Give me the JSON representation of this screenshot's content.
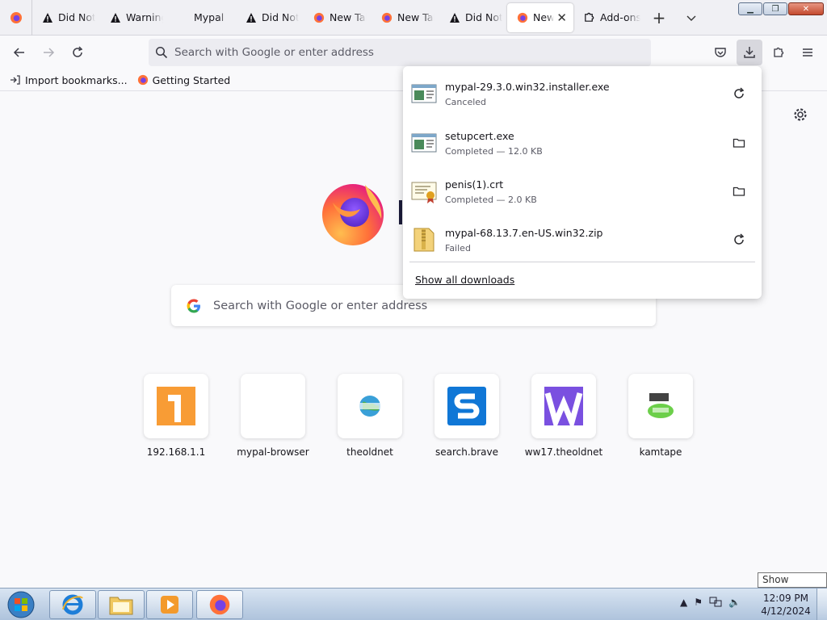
{
  "tabs": [
    {
      "label": "Did Not",
      "icon": "warning-icon"
    },
    {
      "label": "Warning",
      "icon": "warning-icon"
    },
    {
      "label": "Mypal",
      "icon": "none"
    },
    {
      "label": "Did Not",
      "icon": "warning-icon"
    },
    {
      "label": "New Tab",
      "icon": "firefox-icon"
    },
    {
      "label": "New Tab",
      "icon": "firefox-icon"
    },
    {
      "label": "Did Not",
      "icon": "warning-icon"
    },
    {
      "label": "New",
      "icon": "firefox-icon",
      "active": true
    },
    {
      "label": "Add-ons",
      "icon": "puzzle-icon"
    }
  ],
  "toolbar": {
    "url_placeholder": "Search with Google or enter address"
  },
  "bookmarks": [
    {
      "label": "Import bookmarks...",
      "icon": "import-icon"
    },
    {
      "label": "Getting Started",
      "icon": "firefox-icon"
    }
  ],
  "newtab": {
    "search_placeholder": "Search with Google or enter address",
    "tiles": [
      {
        "label": "192.168.1.1",
        "icon": "number-one-icon"
      },
      {
        "label": "mypal-browser",
        "icon": "blank-icon"
      },
      {
        "label": "theoldnet",
        "icon": "globe-icon"
      },
      {
        "label": "search.brave",
        "icon": "brave-s-icon"
      },
      {
        "label": "ww17.theoldnet",
        "icon": "w-letter-icon"
      },
      {
        "label": "kamtape",
        "icon": "kamtape-icon"
      }
    ]
  },
  "downloads": {
    "items": [
      {
        "name": "mypal-29.3.0.win32.installer.exe",
        "status": "Canceled",
        "action": "retry-icon",
        "file_icon": "exe-icon"
      },
      {
        "name": "setupcert.exe",
        "status": "Completed — 12.0 KB",
        "action": "folder-icon",
        "file_icon": "exe-icon"
      },
      {
        "name": "penis(1).crt",
        "status": "Completed — 2.0 KB",
        "action": "folder-icon",
        "file_icon": "certificate-icon"
      },
      {
        "name": "mypal-68.13.7.en-US.win32.zip",
        "status": "Failed",
        "action": "retry-icon",
        "file_icon": "zip-icon"
      }
    ],
    "show_all": "Show all downloads"
  },
  "taskbar": {
    "time": "12:09 PM",
    "date": "4/12/2024",
    "tooltip": "Show desktop"
  }
}
